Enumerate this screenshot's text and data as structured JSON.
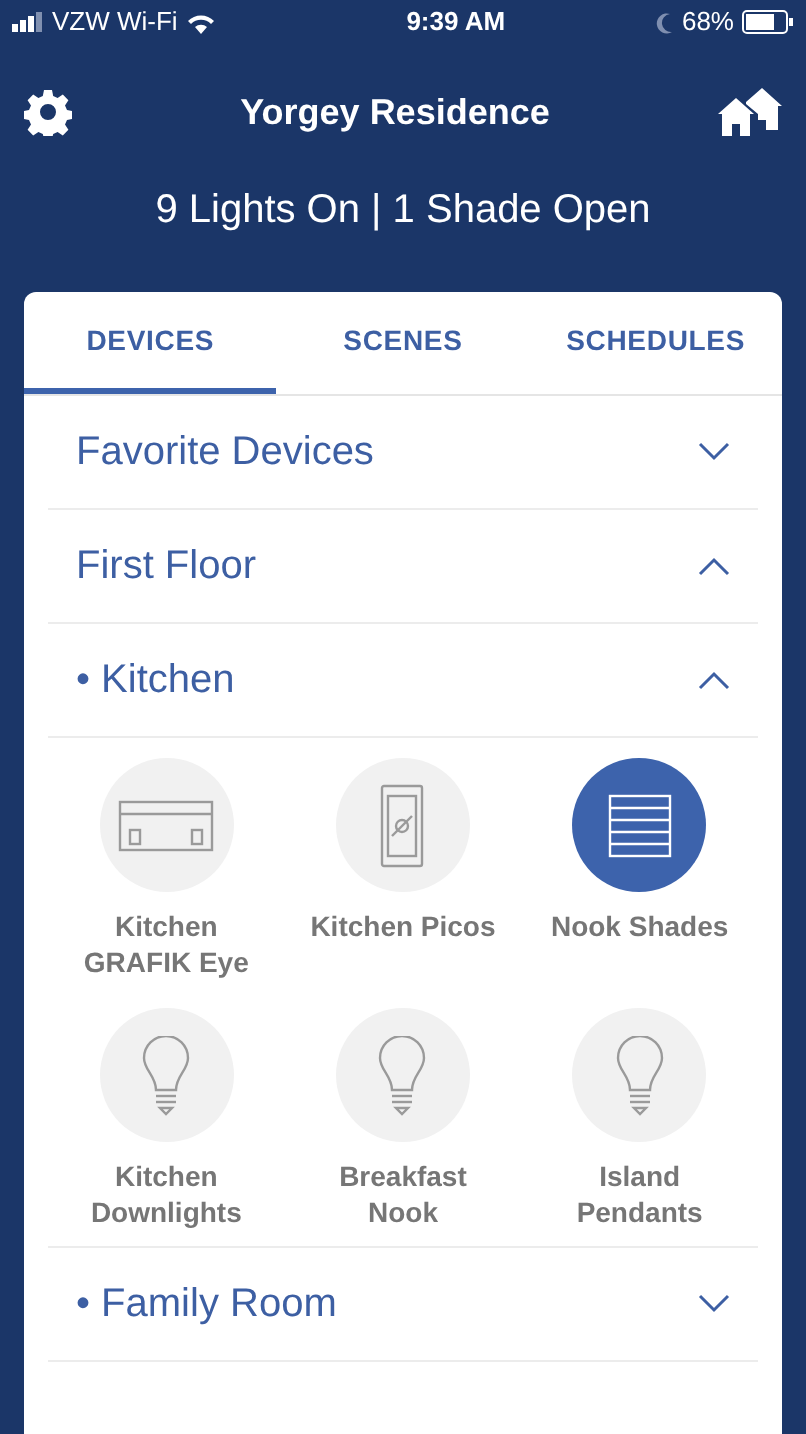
{
  "status_bar": {
    "carrier": "VZW Wi-Fi",
    "time": "9:39 AM",
    "battery": "68%"
  },
  "header": {
    "title": "Yorgey Residence"
  },
  "summary": "9 Lights On | 1 Shade Open",
  "tabs": [
    {
      "label": "DEVICES",
      "selected": true
    },
    {
      "label": "SCENES",
      "selected": false
    },
    {
      "label": "SCHEDULES",
      "selected": false
    }
  ],
  "sections": [
    {
      "label": "Favorite Devices",
      "expanded": false
    },
    {
      "label": "First Floor",
      "expanded": true,
      "children": [
        {
          "label": "• Kitchen",
          "expanded": true,
          "devices": [
            {
              "kind": "grafik",
              "label": "Kitchen GRAFIK Eye",
              "active": false
            },
            {
              "kind": "pico",
              "label": "Kitchen Picos",
              "active": false
            },
            {
              "kind": "shade",
              "label": "Nook Shades",
              "active": true
            },
            {
              "kind": "bulb",
              "label": "Kitchen Downlights",
              "active": false
            },
            {
              "kind": "bulb",
              "label": "Breakfast Nook",
              "active": false
            },
            {
              "kind": "bulb",
              "label": "Island Pendants",
              "active": false
            }
          ]
        },
        {
          "label": "• Family Room",
          "expanded": false
        }
      ]
    }
  ]
}
